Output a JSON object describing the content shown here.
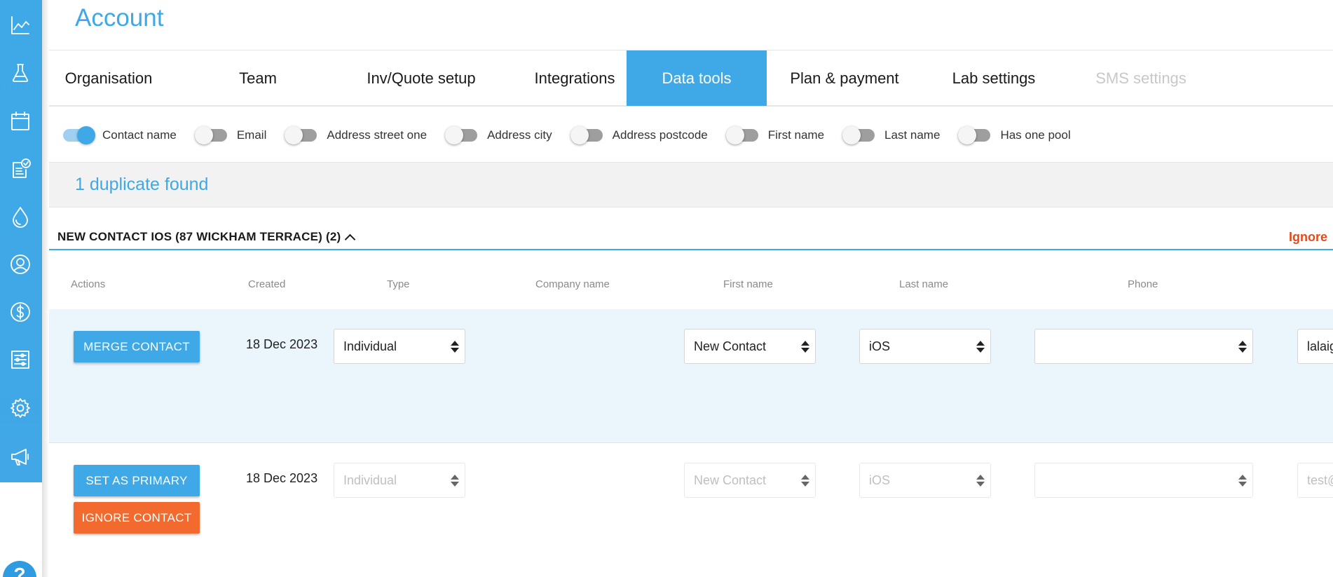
{
  "page": {
    "title": "Account"
  },
  "tabs": [
    {
      "label": "Organisation",
      "state": "normal"
    },
    {
      "label": "Team",
      "state": "normal"
    },
    {
      "label": "Inv/Quote setup",
      "state": "normal"
    },
    {
      "label": "Integrations",
      "state": "normal"
    },
    {
      "label": "Data tools",
      "state": "active"
    },
    {
      "label": "Plan & payment",
      "state": "normal"
    },
    {
      "label": "Lab settings",
      "state": "normal"
    },
    {
      "label": "SMS settings",
      "state": "disabled"
    }
  ],
  "match_toggles": [
    {
      "label": "Contact name",
      "on": true
    },
    {
      "label": "Email",
      "on": false
    },
    {
      "label": "Address street one",
      "on": false
    },
    {
      "label": "Address city",
      "on": false
    },
    {
      "label": "Address postcode",
      "on": false
    },
    {
      "label": "First name",
      "on": false
    },
    {
      "label": "Last name",
      "on": false
    },
    {
      "label": "Has one pool",
      "on": false
    }
  ],
  "duplicates": {
    "summary": "1 duplicate found",
    "group": {
      "title": "NEW CONTACT IOS (87 WICKHAM TERRACE) (2)",
      "ignore_label": "Ignore"
    },
    "columns": [
      "Actions",
      "Created",
      "Type",
      "Company name",
      "First name",
      "Last name",
      "Phone"
    ],
    "rows": [
      {
        "buttons": [
          "MERGE CONTACT"
        ],
        "created": "18 Dec 2023",
        "type": "Individual",
        "first_name": "New Contact",
        "last_name": "iOS",
        "phone": "",
        "email_partial": "lalaig"
      },
      {
        "buttons": [
          "SET AS PRIMARY",
          "IGNORE CONTACT"
        ],
        "created": "18 Dec 2023",
        "type": "Individual",
        "first_name": "New Contact",
        "last_name": "iOS",
        "phone": "",
        "email_partial": "test@"
      }
    ]
  },
  "sidebar": {
    "icons": [
      "chart-line-icon",
      "flask-icon",
      "calendar-icon",
      "clipboard-check-icon",
      "water-drop-icon",
      "user-circle-icon",
      "dollar-circle-icon",
      "sliders-icon",
      "gear-icon",
      "megaphone-icon"
    ],
    "help_icon": "help-icon"
  },
  "colors": {
    "accent": "#3ea9e6",
    "danger": "#e64a19",
    "orange": "#f26a2e"
  }
}
